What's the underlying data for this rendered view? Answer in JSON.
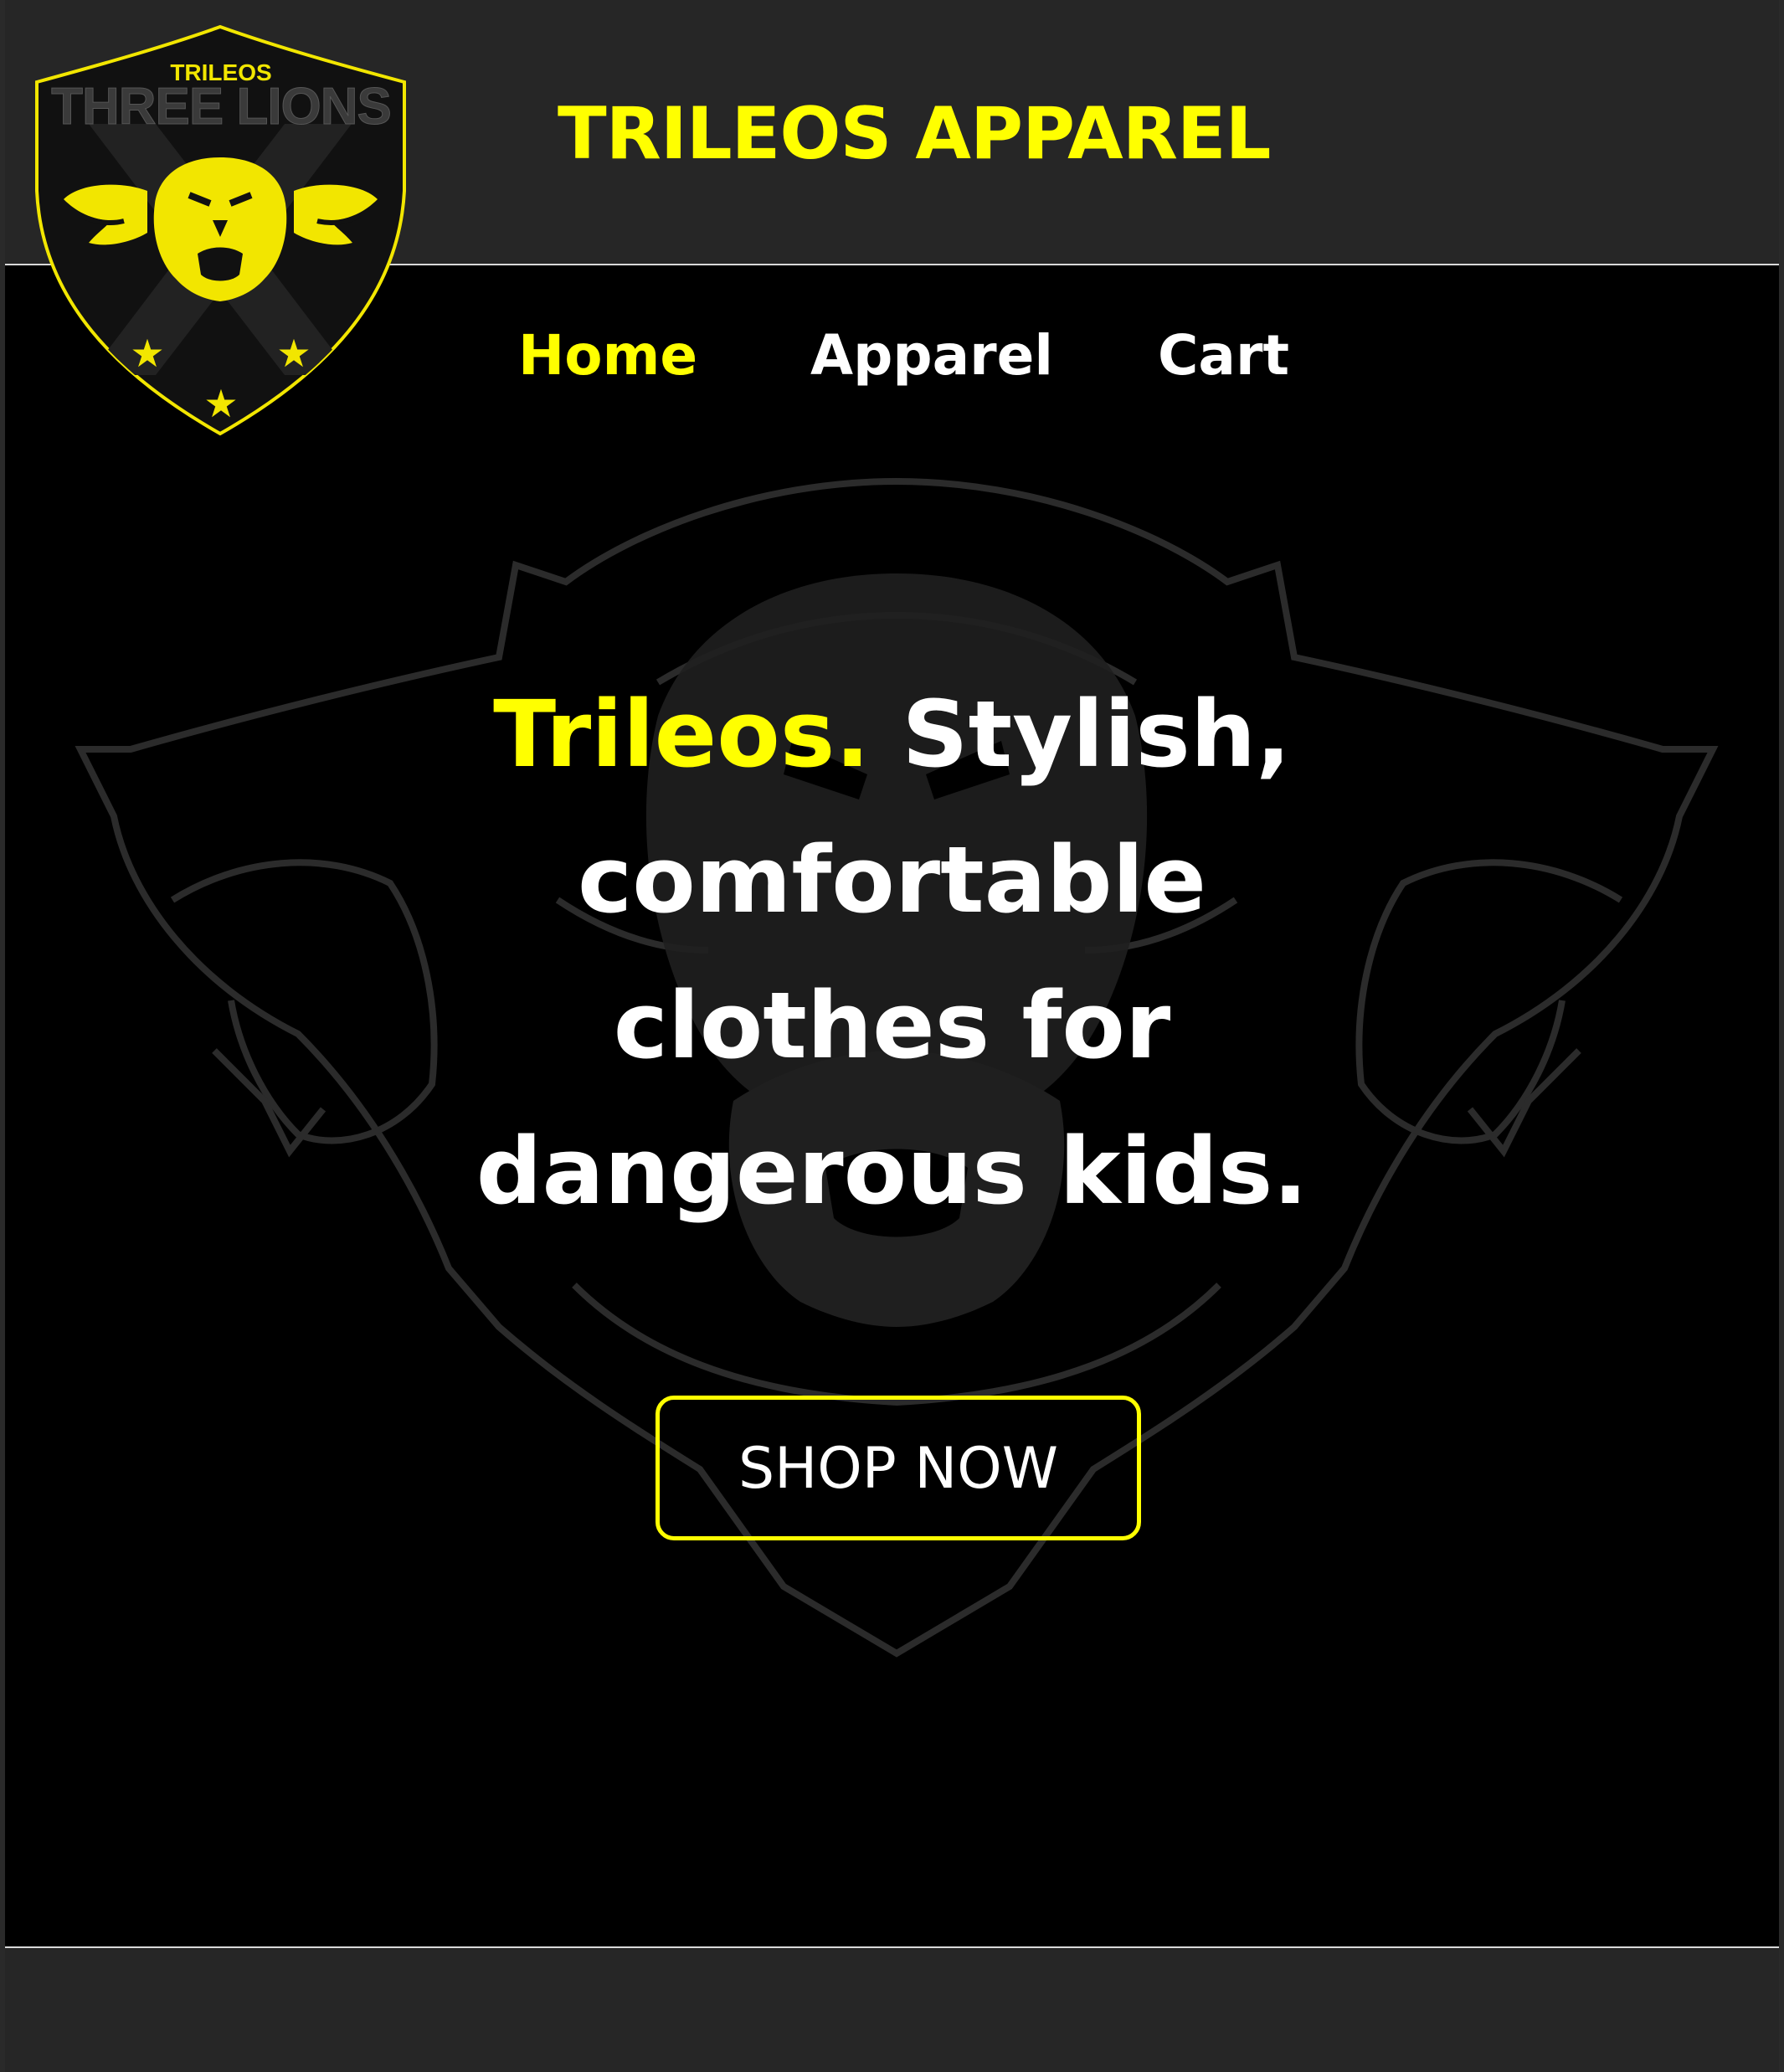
{
  "header": {
    "title": "TRILEOS APPAREL",
    "logo_top_text": "TRILEOS",
    "logo_main_text": "THREE LIONS"
  },
  "nav": {
    "items": [
      {
        "label": "Home",
        "active": true
      },
      {
        "label": "Apparel",
        "active": false
      },
      {
        "label": "Cart",
        "active": false
      }
    ]
  },
  "hero": {
    "brand": "Trileos.",
    "line1_rest": " Stylish,",
    "line2": "comfortable",
    "line3": "clothes for",
    "line4": "dangerous kids."
  },
  "cta": {
    "label": "SHOP NOW"
  },
  "colors": {
    "accent": "#ffff00",
    "header_bg": "#262626",
    "body_bg": "#000000",
    "text": "#ffffff"
  }
}
